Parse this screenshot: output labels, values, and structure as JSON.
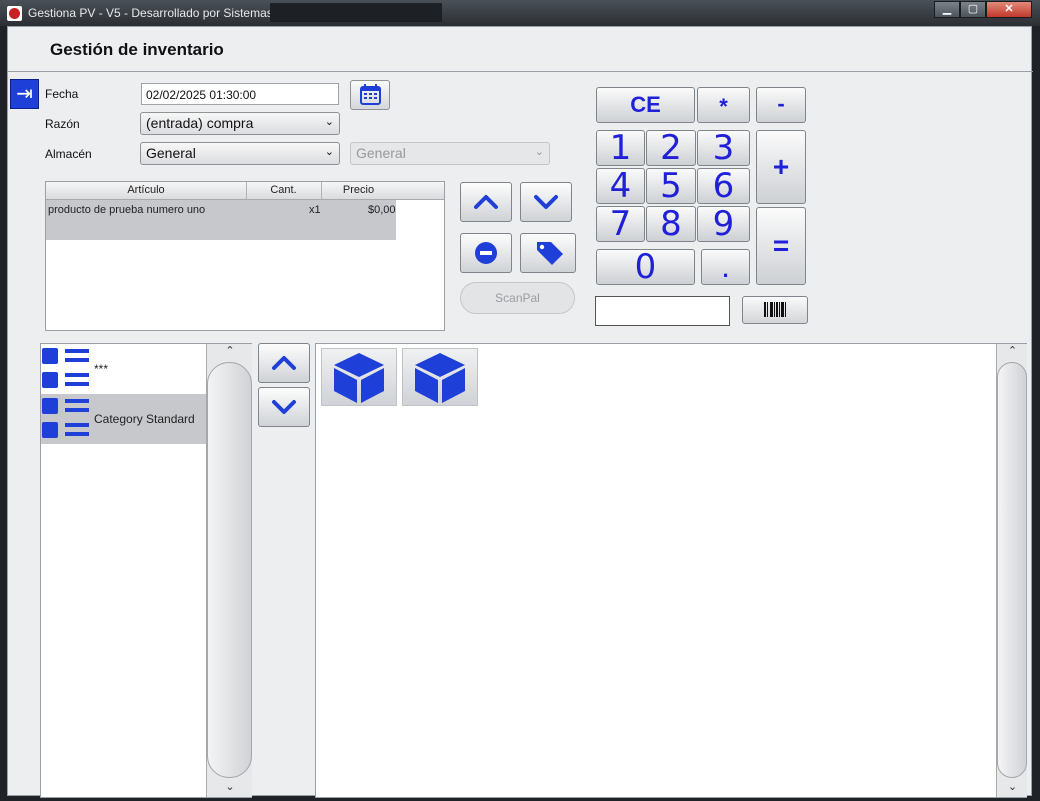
{
  "window": {
    "title": "Gestiona PV - V5 - Desarrollado por Sistemas",
    "minimize_label": "▁",
    "maximize_label": "▢",
    "close_label": "✕"
  },
  "page": {
    "title": "Gestión de inventario"
  },
  "form": {
    "fecha_label": "Fecha",
    "fecha_value": "02/02/2025 01:30:00",
    "razon_label": "Razón",
    "razon_value": "(entrada) compra",
    "almacen_label": "Almacén",
    "almacen_value": "General",
    "almacen2_value": "General"
  },
  "table": {
    "headers": [
      "Artículo",
      "Cant.",
      "Precio"
    ],
    "rows": [
      {
        "articulo": "producto de prueba numero uno",
        "cant": "x1",
        "precio": "$0,00"
      }
    ]
  },
  "actions": {
    "scanpal_label": "ScanPal"
  },
  "keypad": {
    "ce": "CE",
    "mult": "*",
    "minus": "-",
    "plus": "+",
    "equals": "=",
    "dot": ".",
    "digits": [
      "1",
      "2",
      "3",
      "4",
      "5",
      "6",
      "7",
      "8",
      "9",
      "0"
    ],
    "display_value": ""
  },
  "categories": {
    "items": [
      {
        "label": "***"
      },
      {
        "label": "Category Standard"
      }
    ]
  },
  "products": {
    "items": [
      {
        "icon": "box-icon"
      },
      {
        "icon": "box-icon"
      }
    ]
  },
  "colors": {
    "accent_blue": "#1e3fd8",
    "keypad_text": "#2020d8"
  }
}
